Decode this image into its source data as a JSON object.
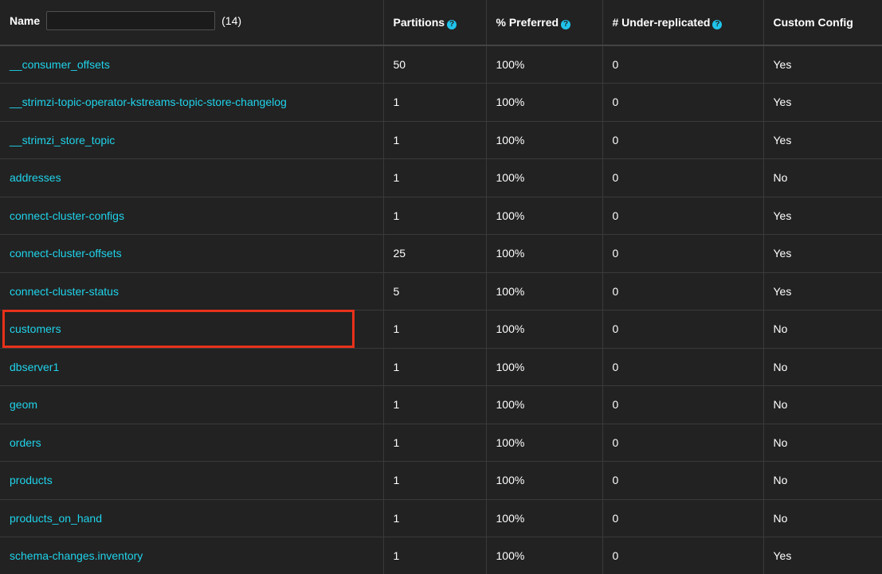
{
  "header": {
    "name_label": "Name",
    "filter_value": "",
    "count": "(14)",
    "partitions": "Partitions",
    "preferred": "% Preferred",
    "under_replicated": "# Under-replicated",
    "custom_config": "Custom Config",
    "help_glyph": "?"
  },
  "rows": [
    {
      "name": "__consumer_offsets",
      "partitions": "50",
      "preferred": "100%",
      "under_replicated": "0",
      "custom_config": "Yes"
    },
    {
      "name": "__strimzi-topic-operator-kstreams-topic-store-changelog",
      "partitions": "1",
      "preferred": "100%",
      "under_replicated": "0",
      "custom_config": "Yes"
    },
    {
      "name": "__strimzi_store_topic",
      "partitions": "1",
      "preferred": "100%",
      "under_replicated": "0",
      "custom_config": "Yes"
    },
    {
      "name": "addresses",
      "partitions": "1",
      "preferred": "100%",
      "under_replicated": "0",
      "custom_config": "No"
    },
    {
      "name": "connect-cluster-configs",
      "partitions": "1",
      "preferred": "100%",
      "under_replicated": "0",
      "custom_config": "Yes"
    },
    {
      "name": "connect-cluster-offsets",
      "partitions": "25",
      "preferred": "100%",
      "under_replicated": "0",
      "custom_config": "Yes"
    },
    {
      "name": "connect-cluster-status",
      "partitions": "5",
      "preferred": "100%",
      "under_replicated": "0",
      "custom_config": "Yes"
    },
    {
      "name": "customers",
      "partitions": "1",
      "preferred": "100%",
      "under_replicated": "0",
      "custom_config": "No"
    },
    {
      "name": "dbserver1",
      "partitions": "1",
      "preferred": "100%",
      "under_replicated": "0",
      "custom_config": "No"
    },
    {
      "name": "geom",
      "partitions": "1",
      "preferred": "100%",
      "under_replicated": "0",
      "custom_config": "No"
    },
    {
      "name": "orders",
      "partitions": "1",
      "preferred": "100%",
      "under_replicated": "0",
      "custom_config": "No"
    },
    {
      "name": "products",
      "partitions": "1",
      "preferred": "100%",
      "under_replicated": "0",
      "custom_config": "No"
    },
    {
      "name": "products_on_hand",
      "partitions": "1",
      "preferred": "100%",
      "under_replicated": "0",
      "custom_config": "No"
    },
    {
      "name": "schema-changes.inventory",
      "partitions": "1",
      "preferred": "100%",
      "under_replicated": "0",
      "custom_config": "Yes"
    }
  ],
  "highlight": {
    "row_name": "customers",
    "color": "#e8311a"
  },
  "colors": {
    "background": "#222222",
    "link": "#1fd3ea",
    "help_icon": "#1fc3ea"
  }
}
